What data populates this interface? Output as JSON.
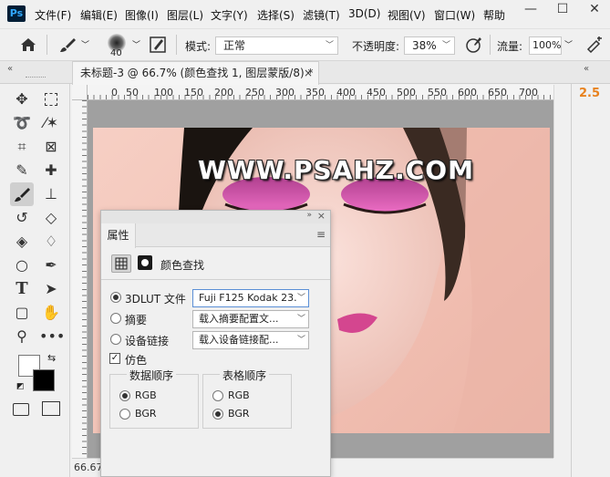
{
  "app": {
    "logo": "Ps"
  },
  "menu": {
    "items": [
      "文件(F)",
      "编辑(E)",
      "图像(I)",
      "图层(L)",
      "文字(Y)",
      "选择(S)",
      "滤镜(T)",
      "3D(D)",
      "视图(V)",
      "窗口(W)",
      "帮助"
    ]
  },
  "window_controls": {
    "minimize": "—",
    "maximize": "☐",
    "close": "✕"
  },
  "options": {
    "brush_size": "40",
    "mode_label": "模式:",
    "mode_value": "正常",
    "opacity_label": "不透明度:",
    "opacity_value": "38%",
    "flow_label": "流量:",
    "flow_value": "100%"
  },
  "document": {
    "tab_title": "未标题-3 @ 66.7% (颜色查找 1, 图层蒙版/8) *",
    "close": "×",
    "watermark": "WWW.PSAHZ.COM",
    "zoom_readout": "66.67"
  },
  "ruler": {
    "top_labels": [
      "0",
      "50",
      "100",
      "150",
      "200",
      "250",
      "300",
      "350",
      "400",
      "450",
      "500",
      "550",
      "600",
      "650",
      "700"
    ]
  },
  "right_panel": {
    "value": "2.5"
  },
  "properties": {
    "tab": "属性",
    "title": "颜色查找",
    "lut_file_label": "3DLUT 文件",
    "lut_file_value": "Fuji F125 Kodak 23...",
    "abstract_label": "摘要",
    "abstract_value": "载入摘要配置文...",
    "device_link_label": "设备链接",
    "device_link_value": "载入设备链接配...",
    "dither_label": "仿色",
    "dither_checked": true,
    "data_order_title": "数据顺序",
    "table_order_title": "表格顺序",
    "rgb": "RGB",
    "bgr": "BGR"
  },
  "colors": {
    "accent": "#e8821e",
    "ps_dark": "#001e36",
    "ps_blue": "#31a8ff",
    "eyeshadow": "#d94aa4"
  }
}
